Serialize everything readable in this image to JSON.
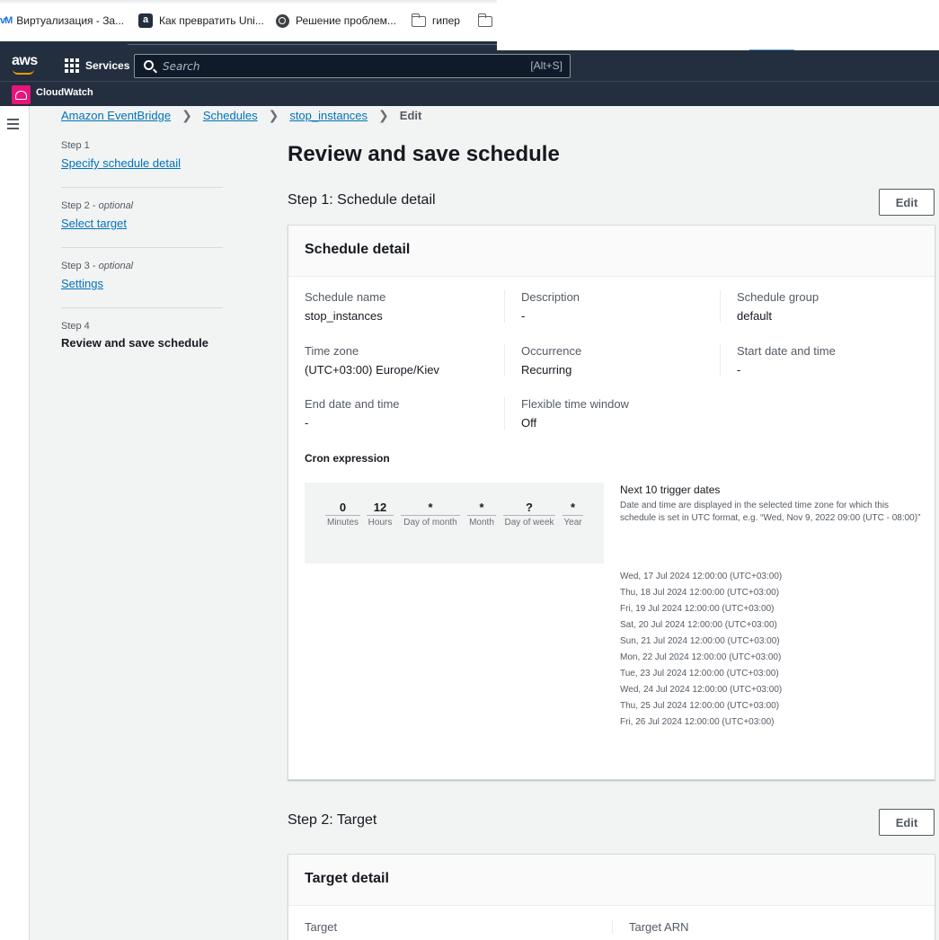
{
  "bookmarks": [
    {
      "label": "Виртуализация - За...",
      "icon": "vm-icon",
      "glyph": "vM"
    },
    {
      "label": "Как превратить Uni...",
      "icon": "a-icon",
      "glyph": "a"
    },
    {
      "label": "Решение проблем...",
      "icon": "globe-icon"
    },
    {
      "label": "гипер",
      "icon": "folder-icon"
    },
    {
      "label": "",
      "icon": "folder-icon"
    }
  ],
  "nav": {
    "logo": "aws",
    "services_label": "Services",
    "search_placeholder": "Search",
    "search_shortcut": "[Alt+S]",
    "service_name": "CloudWatch"
  },
  "breadcrumb": {
    "items": [
      "Amazon EventBridge",
      "Schedules",
      "stop_instances"
    ],
    "current": "Edit"
  },
  "wizard": [
    {
      "step": "Step 1",
      "optional": "",
      "label": "Specify schedule detail"
    },
    {
      "step": "Step 2",
      "optional": "optional",
      "label": "Select target"
    },
    {
      "step": "Step 3",
      "optional": "optional",
      "label": "Settings"
    },
    {
      "step": "Step 4",
      "optional": "",
      "label": "Review and save schedule"
    }
  ],
  "page_title": "Review and save schedule",
  "edit_label": "Edit",
  "step1": {
    "heading": "Step 1: Schedule detail",
    "card_title": "Schedule detail",
    "fields": [
      {
        "key": "Schedule name",
        "value": "stop_instances"
      },
      {
        "key": "Description",
        "value": "-"
      },
      {
        "key": "Schedule group",
        "value": "default"
      },
      {
        "key": "Time zone",
        "value": "(UTC+03:00) Europe/Kiev"
      },
      {
        "key": "Occurrence",
        "value": "Recurring"
      },
      {
        "key": "Start date and time",
        "value": "-"
      },
      {
        "key": "End date and time",
        "value": "-"
      },
      {
        "key": "Flexible time window",
        "value": "Off"
      }
    ],
    "cron_title": "Cron expression",
    "cron": [
      {
        "value": "0",
        "label": "Minutes"
      },
      {
        "value": "12",
        "label": "Hours"
      },
      {
        "value": "*",
        "label": "Day of month"
      },
      {
        "value": "*",
        "label": "Month"
      },
      {
        "value": "?",
        "label": "Day of week"
      },
      {
        "value": "*",
        "label": "Year"
      }
    ],
    "trigger_title": "Next 10 trigger dates",
    "trigger_desc": "Date and time are displayed in the selected time zone for which this schedule is set in UTC format, e.g. “Wed, Nov 9, 2022 09:00 (UTC - 08:00)”",
    "trigger_dates": [
      "Wed, 17 Jul 2024 12:00:00 (UTC+03:00)",
      "Thu, 18 Jul 2024 12:00:00 (UTC+03:00)",
      "Fri, 19 Jul 2024 12:00:00 (UTC+03:00)",
      "Sat, 20 Jul 2024 12:00:00 (UTC+03:00)",
      "Sun, 21 Jul 2024 12:00:00 (UTC+03:00)",
      "Mon, 22 Jul 2024 12:00:00 (UTC+03:00)",
      "Tue, 23 Jul 2024 12:00:00 (UTC+03:00)",
      "Wed, 24 Jul 2024 12:00:00 (UTC+03:00)",
      "Thu, 25 Jul 2024 12:00:00 (UTC+03:00)",
      "Fri, 26 Jul 2024 12:00:00 (UTC+03:00)"
    ]
  },
  "step2": {
    "heading": "Step 2: Target",
    "card_title": "Target detail",
    "fields": [
      {
        "key": "Target"
      },
      {
        "key": "Target ARN"
      }
    ]
  },
  "colors": {
    "nav_bg": "#232f3e",
    "link": "#0073bb",
    "cloudwatch": "#e7157b",
    "aws_smile": "#ff9900"
  }
}
